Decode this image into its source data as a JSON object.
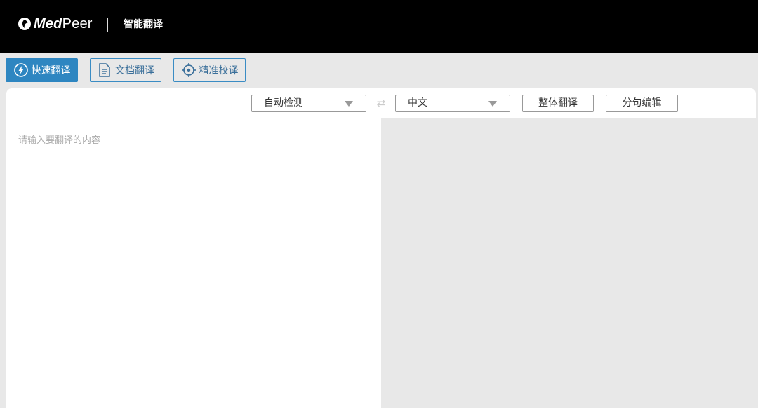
{
  "header": {
    "logo_med": "Med",
    "logo_peer": "Peer",
    "app_title": "智能翻译"
  },
  "modes": [
    {
      "label": "快速翻译",
      "icon": "lightning-icon",
      "active": true
    },
    {
      "label": "文档翻译",
      "icon": "document-icon",
      "active": false
    },
    {
      "label": "精准校译",
      "icon": "crosshair-icon",
      "active": false
    }
  ],
  "toolbar": {
    "source_language": "自动检测",
    "target_language": "中文",
    "swap_icon": "swap-arrows-icon",
    "whole_translate_label": "整体翻译",
    "sentence_edit_label": "分句编辑"
  },
  "input": {
    "placeholder": "请输入要翻译的内容",
    "value": ""
  },
  "colors": {
    "accent": "#2e86c1",
    "header_bg": "#000000",
    "page_bg": "#e8e8e8"
  }
}
